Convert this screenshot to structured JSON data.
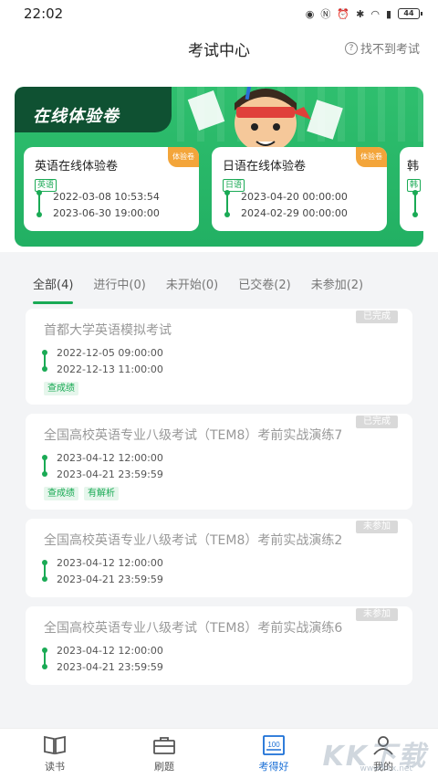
{
  "status_bar": {
    "time": "22:02",
    "battery": "44"
  },
  "header": {
    "title": "考试中心",
    "help_label": "找不到考试"
  },
  "banner": {
    "title": "在线体验卷"
  },
  "trial_cards": [
    {
      "title": "英语在线体验卷",
      "tag": "英语",
      "badge": "体验卷",
      "start": "2022-03-08 10:53:54",
      "end": "2023-06-30 19:00:00"
    },
    {
      "title": "日语在线体验卷",
      "tag": "日语",
      "badge": "体验卷",
      "start": "2023-04-20 00:00:00",
      "end": "2024-02-29 00:00:00"
    },
    {
      "title": "韩",
      "tag": "韩"
    }
  ],
  "tabs": [
    {
      "label": "全部(4)",
      "active": true
    },
    {
      "label": "进行中(0)"
    },
    {
      "label": "未开始(0)"
    },
    {
      "label": "已交卷(2)"
    },
    {
      "label": "未参加(2)"
    }
  ],
  "exams": [
    {
      "title": "首都大学英语模拟考试",
      "status": "已完成",
      "start": "2022-12-05 09:00:00",
      "end": "2022-12-13 11:00:00",
      "actions": [
        "查成绩"
      ]
    },
    {
      "title": "全国高校英语专业八级考试（TEM8）考前实战演练7",
      "status": "已完成",
      "start": "2023-04-12 12:00:00",
      "end": "2023-04-21 23:59:59",
      "actions": [
        "查成绩",
        "有解析"
      ]
    },
    {
      "title": "全国高校英语专业八级考试（TEM8）考前实战演练2",
      "status": "未参加",
      "start": "2023-04-12 12:00:00",
      "end": "2023-04-21 23:59:59",
      "actions": []
    },
    {
      "title": "全国高校英语专业八级考试（TEM8）考前实战演练6",
      "status": "未参加",
      "start": "2023-04-12 12:00:00",
      "end": "2023-04-21 23:59:59",
      "actions": []
    }
  ],
  "bottom_nav": [
    {
      "label": "读书",
      "icon": "book-icon"
    },
    {
      "label": "刷题",
      "icon": "briefcase-icon"
    },
    {
      "label": "考得好",
      "icon": "score-100-icon",
      "active": true
    },
    {
      "label": "我的",
      "icon": "profile-icon"
    }
  ],
  "watermark": {
    "text": "KK下载",
    "url": "www.kkx.net"
  },
  "colors": {
    "accent_green": "#1aaa55",
    "banner_green": "#2fbf6e",
    "nav_active": "#1a6fd6"
  }
}
